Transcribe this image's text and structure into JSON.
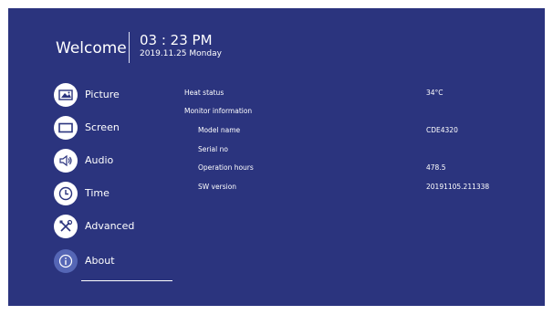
{
  "header": {
    "welcome": "Welcome",
    "time": "03 : 23 PM",
    "date": "2019.11.25 Monday"
  },
  "menu": [
    {
      "label": "Picture",
      "icon": "picture-icon"
    },
    {
      "label": "Screen",
      "icon": "screen-icon"
    },
    {
      "label": "Audio",
      "icon": "speaker-icon"
    },
    {
      "label": "Time",
      "icon": "clock-icon"
    },
    {
      "label": "Advanced",
      "icon": "tools-icon"
    },
    {
      "label": "About",
      "icon": "info-icon",
      "selected": true
    }
  ],
  "about": {
    "heat_status_label": "Heat status",
    "heat_status_value": "34°C",
    "monitor_info_label": "Monitor information",
    "model_name_label": "Model name",
    "model_name_value": "CDE4320",
    "serial_no_label": "Serial no",
    "serial_no_value": "",
    "operation_hours_label": "Operation hours",
    "operation_hours_value": "478.5",
    "sw_version_label": "SW version",
    "sw_version_value": "20191105.211338"
  },
  "colors": {
    "background": "#2b347e",
    "selected_icon": "#5566b5",
    "text": "#ffffff"
  }
}
